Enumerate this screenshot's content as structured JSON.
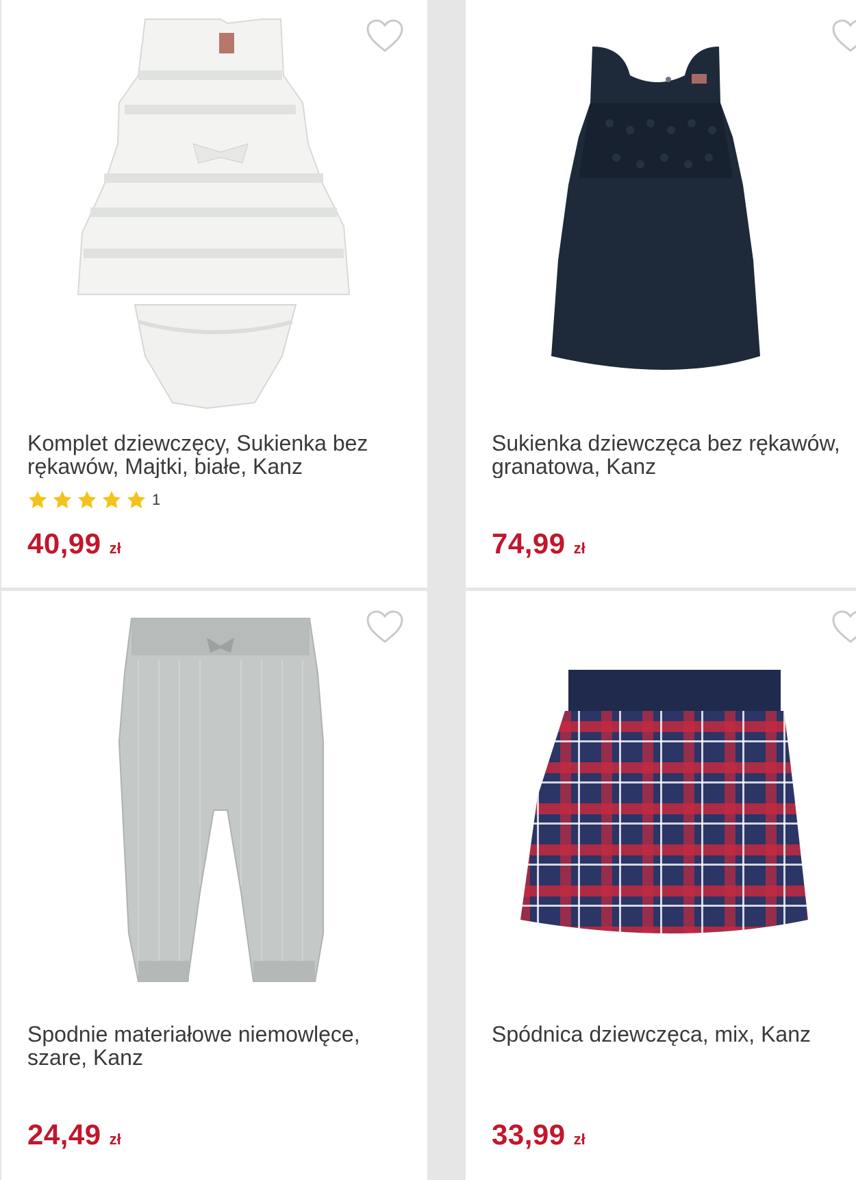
{
  "colors": {
    "price": "#c1172c",
    "star": "#f5c21b",
    "text": "#3a3a3a",
    "background": "#e6e6e6"
  },
  "products": [
    {
      "title": "Komplet dziewczęcy, Sukienka bez\nrękawów, Majtki, białe, Kanz",
      "rating_count": "1",
      "stars": 5,
      "price": "40,99",
      "currency": "zł",
      "favorite_icon": "heart-outline-icon",
      "image": "white-striped-dress-with-bloomers"
    },
    {
      "title": "Sukienka dziewczęca bez rękawów,\ngranatowa, Kanz",
      "price": "74,99",
      "currency": "zł",
      "favorite_icon": "heart-outline-icon",
      "image": "navy-lace-tulle-dress"
    },
    {
      "title": "Spodnie materiałowe niemowlęce,\nszare, Kanz",
      "price": "24,49",
      "currency": "zł",
      "favorite_icon": "heart-outline-icon",
      "image": "grey-baby-trousers"
    },
    {
      "title": "Spódnica dziewczęca, mix, Kanz",
      "price": "33,99",
      "currency": "zł",
      "favorite_icon": "heart-outline-icon",
      "image": "plaid-skirt"
    }
  ]
}
